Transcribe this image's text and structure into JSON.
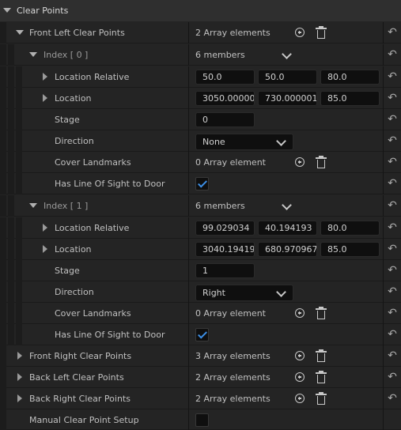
{
  "header": {
    "label": "Clear Points"
  },
  "front_left": {
    "label": "Front Left Clear Points",
    "value": "2 Array elements"
  },
  "index0": {
    "label": "Index [ 0 ]",
    "members": "6 members",
    "location_relative": {
      "label": "Location Relative",
      "x": "50.0",
      "y": "50.0",
      "z": "80.0"
    },
    "location": {
      "label": "Location",
      "x": "3050.00000",
      "y": "730.000001",
      "z": "85.0"
    },
    "stage": {
      "label": "Stage",
      "value": "0"
    },
    "direction": {
      "label": "Direction",
      "value": "None"
    },
    "cover_landmarks": {
      "label": "Cover Landmarks",
      "value": "0 Array element"
    },
    "line_of_sight": {
      "label": "Has Line Of Sight to Door",
      "checked": true
    }
  },
  "index1": {
    "label": "Index [ 1 ]",
    "members": "6 members",
    "location_relative": {
      "label": "Location Relative",
      "x": "99.029034",
      "y": "40.194193",
      "z": "80.0"
    },
    "location": {
      "label": "Location",
      "x": "3040.19419",
      "y": "680.970967",
      "z": "85.0"
    },
    "stage": {
      "label": "Stage",
      "value": "1"
    },
    "direction": {
      "label": "Direction",
      "value": "Right"
    },
    "cover_landmarks": {
      "label": "Cover Landmarks",
      "value": "0 Array element"
    },
    "line_of_sight": {
      "label": "Has Line Of Sight to Door",
      "checked": true
    }
  },
  "front_right": {
    "label": "Front Right Clear Points",
    "value": "3 Array elements"
  },
  "back_left": {
    "label": "Back Left Clear Points",
    "value": "2 Array elements"
  },
  "back_right": {
    "label": "Back Right Clear Points",
    "value": "2 Array elements"
  },
  "manual_setup": {
    "label": "Manual Clear Point Setup",
    "checked": false
  },
  "icons": {
    "reset": "reset-to-default-arrow-icon",
    "add": "plus-circle-icon",
    "delete": "trash-icon",
    "expand": "triangle-expand-icon",
    "check": "checkmark-icon"
  },
  "colors": {
    "accent": "#3d8fe6",
    "panel": "#242424",
    "header": "#2f2f2f",
    "field": "#0f0f0f"
  }
}
